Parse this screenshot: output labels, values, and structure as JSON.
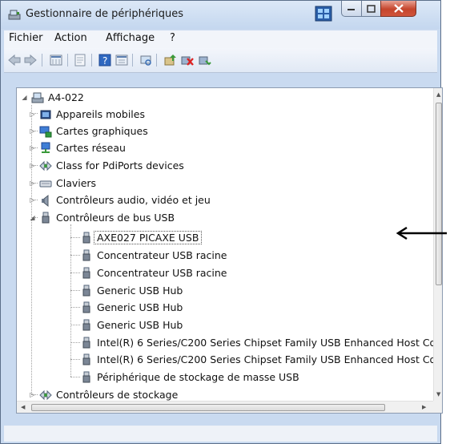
{
  "window": {
    "title": "Gestionnaire de périphériques"
  },
  "menu": {
    "items": [
      "Fichier",
      "Action",
      "Affichage",
      "?"
    ]
  },
  "toolbar": {
    "icons": [
      "back-arrow-icon",
      "forward-arrow-icon",
      "properties-grid-icon",
      "show-hidden-icon",
      "help-icon",
      "view-list-icon",
      "scan-hardware-icon",
      "update-driver-icon",
      "disable-device-icon",
      "uninstall-device-icon"
    ]
  },
  "tree": {
    "root": "A4-022",
    "categories": [
      {
        "label": "Appareils mobiles",
        "icon": "mobile-device-icon",
        "state": "collapsed"
      },
      {
        "label": "Cartes graphiques",
        "icon": "display-adapter-icon",
        "state": "collapsed"
      },
      {
        "label": "Cartes réseau",
        "icon": "network-adapter-icon",
        "state": "collapsed"
      },
      {
        "label": "Class for PdiPorts devices",
        "icon": "pdi-ports-icon",
        "state": "collapsed"
      },
      {
        "label": "Claviers",
        "icon": "keyboard-icon",
        "state": "collapsed"
      },
      {
        "label": "Contrôleurs audio, vidéo et jeu",
        "icon": "audio-icon",
        "state": "collapsed"
      },
      {
        "label": "Contrôleurs de bus USB",
        "icon": "usb-icon",
        "state": "expanded"
      }
    ],
    "usb_children": [
      "AXE027 PICAXE USB",
      "Concentrateur USB racine",
      "Concentrateur USB racine",
      "Generic USB Hub",
      "Generic USB Hub",
      "Generic USB Hub",
      "Intel(R) 6 Series/C200 Series Chipset Family USB Enhanced Host Co",
      "Intel(R) 6 Series/C200 Series Chipset Family USB Enhanced Host Co",
      "Périphérique de stockage de masse USB"
    ],
    "after": {
      "label": "Contrôleurs de stockage",
      "state": "collapsed"
    },
    "selected": "AXE027 PICAXE USB"
  },
  "annotation": {
    "arrow": "pointer-arrow-icon"
  },
  "colors": {
    "accent": "#2d6cb5",
    "frame": "#c9daf0",
    "close": "#c5452c"
  }
}
